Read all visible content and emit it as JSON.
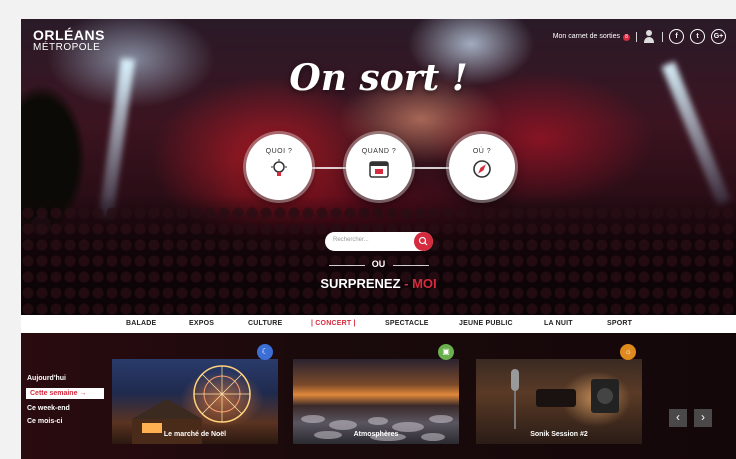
{
  "brand": {
    "line1": "ORLÉANS",
    "line2": "MÉTROPOLE"
  },
  "topbar": {
    "carnet_label": "Mon carnet de sorties",
    "carnet_count": "8",
    "social": [
      "f",
      "t",
      "G+"
    ]
  },
  "hero": {
    "title": "On sort !",
    "questions": [
      {
        "label": "QUOI ?",
        "icon": "lightbulb-icon"
      },
      {
        "label": "QUAND ?",
        "icon": "calendar-icon"
      },
      {
        "label": "OÙ ?",
        "icon": "compass-icon"
      }
    ],
    "search_placeholder": "Rechercher...",
    "ou": "OU",
    "surprise_main": "SURPRENEZ",
    "surprise_dash": " - ",
    "surprise_moi": "MOI"
  },
  "nav": {
    "items": [
      "BALADE",
      "EXPOS",
      "CULTURE",
      "| CONCERT |",
      "SPECTACLE",
      "JEUNE PUBLIC",
      "LA NUIT",
      "SPORT"
    ],
    "active_index": 3
  },
  "periods": [
    "Aujourd'hui",
    "Cette semaine",
    "Ce week-end",
    "Ce mois-ci"
  ],
  "periods_selected": 1,
  "periods_arrow": "→",
  "cards": [
    {
      "caption": "Le marché de Noël",
      "badge_icon": "moon-icon",
      "badge_color": "#3b6fd6"
    },
    {
      "caption": "Atmosphères",
      "badge_icon": "image-icon",
      "badge_color": "#6ab04c"
    },
    {
      "caption": "Sonik Session #2",
      "badge_icon": "sun-icon",
      "badge_color": "#e08a1e"
    }
  ],
  "carousel": {
    "prev": "‹",
    "next": "›"
  },
  "colors": {
    "accent": "#d62b3f",
    "nav_bg": "#ffffff"
  }
}
